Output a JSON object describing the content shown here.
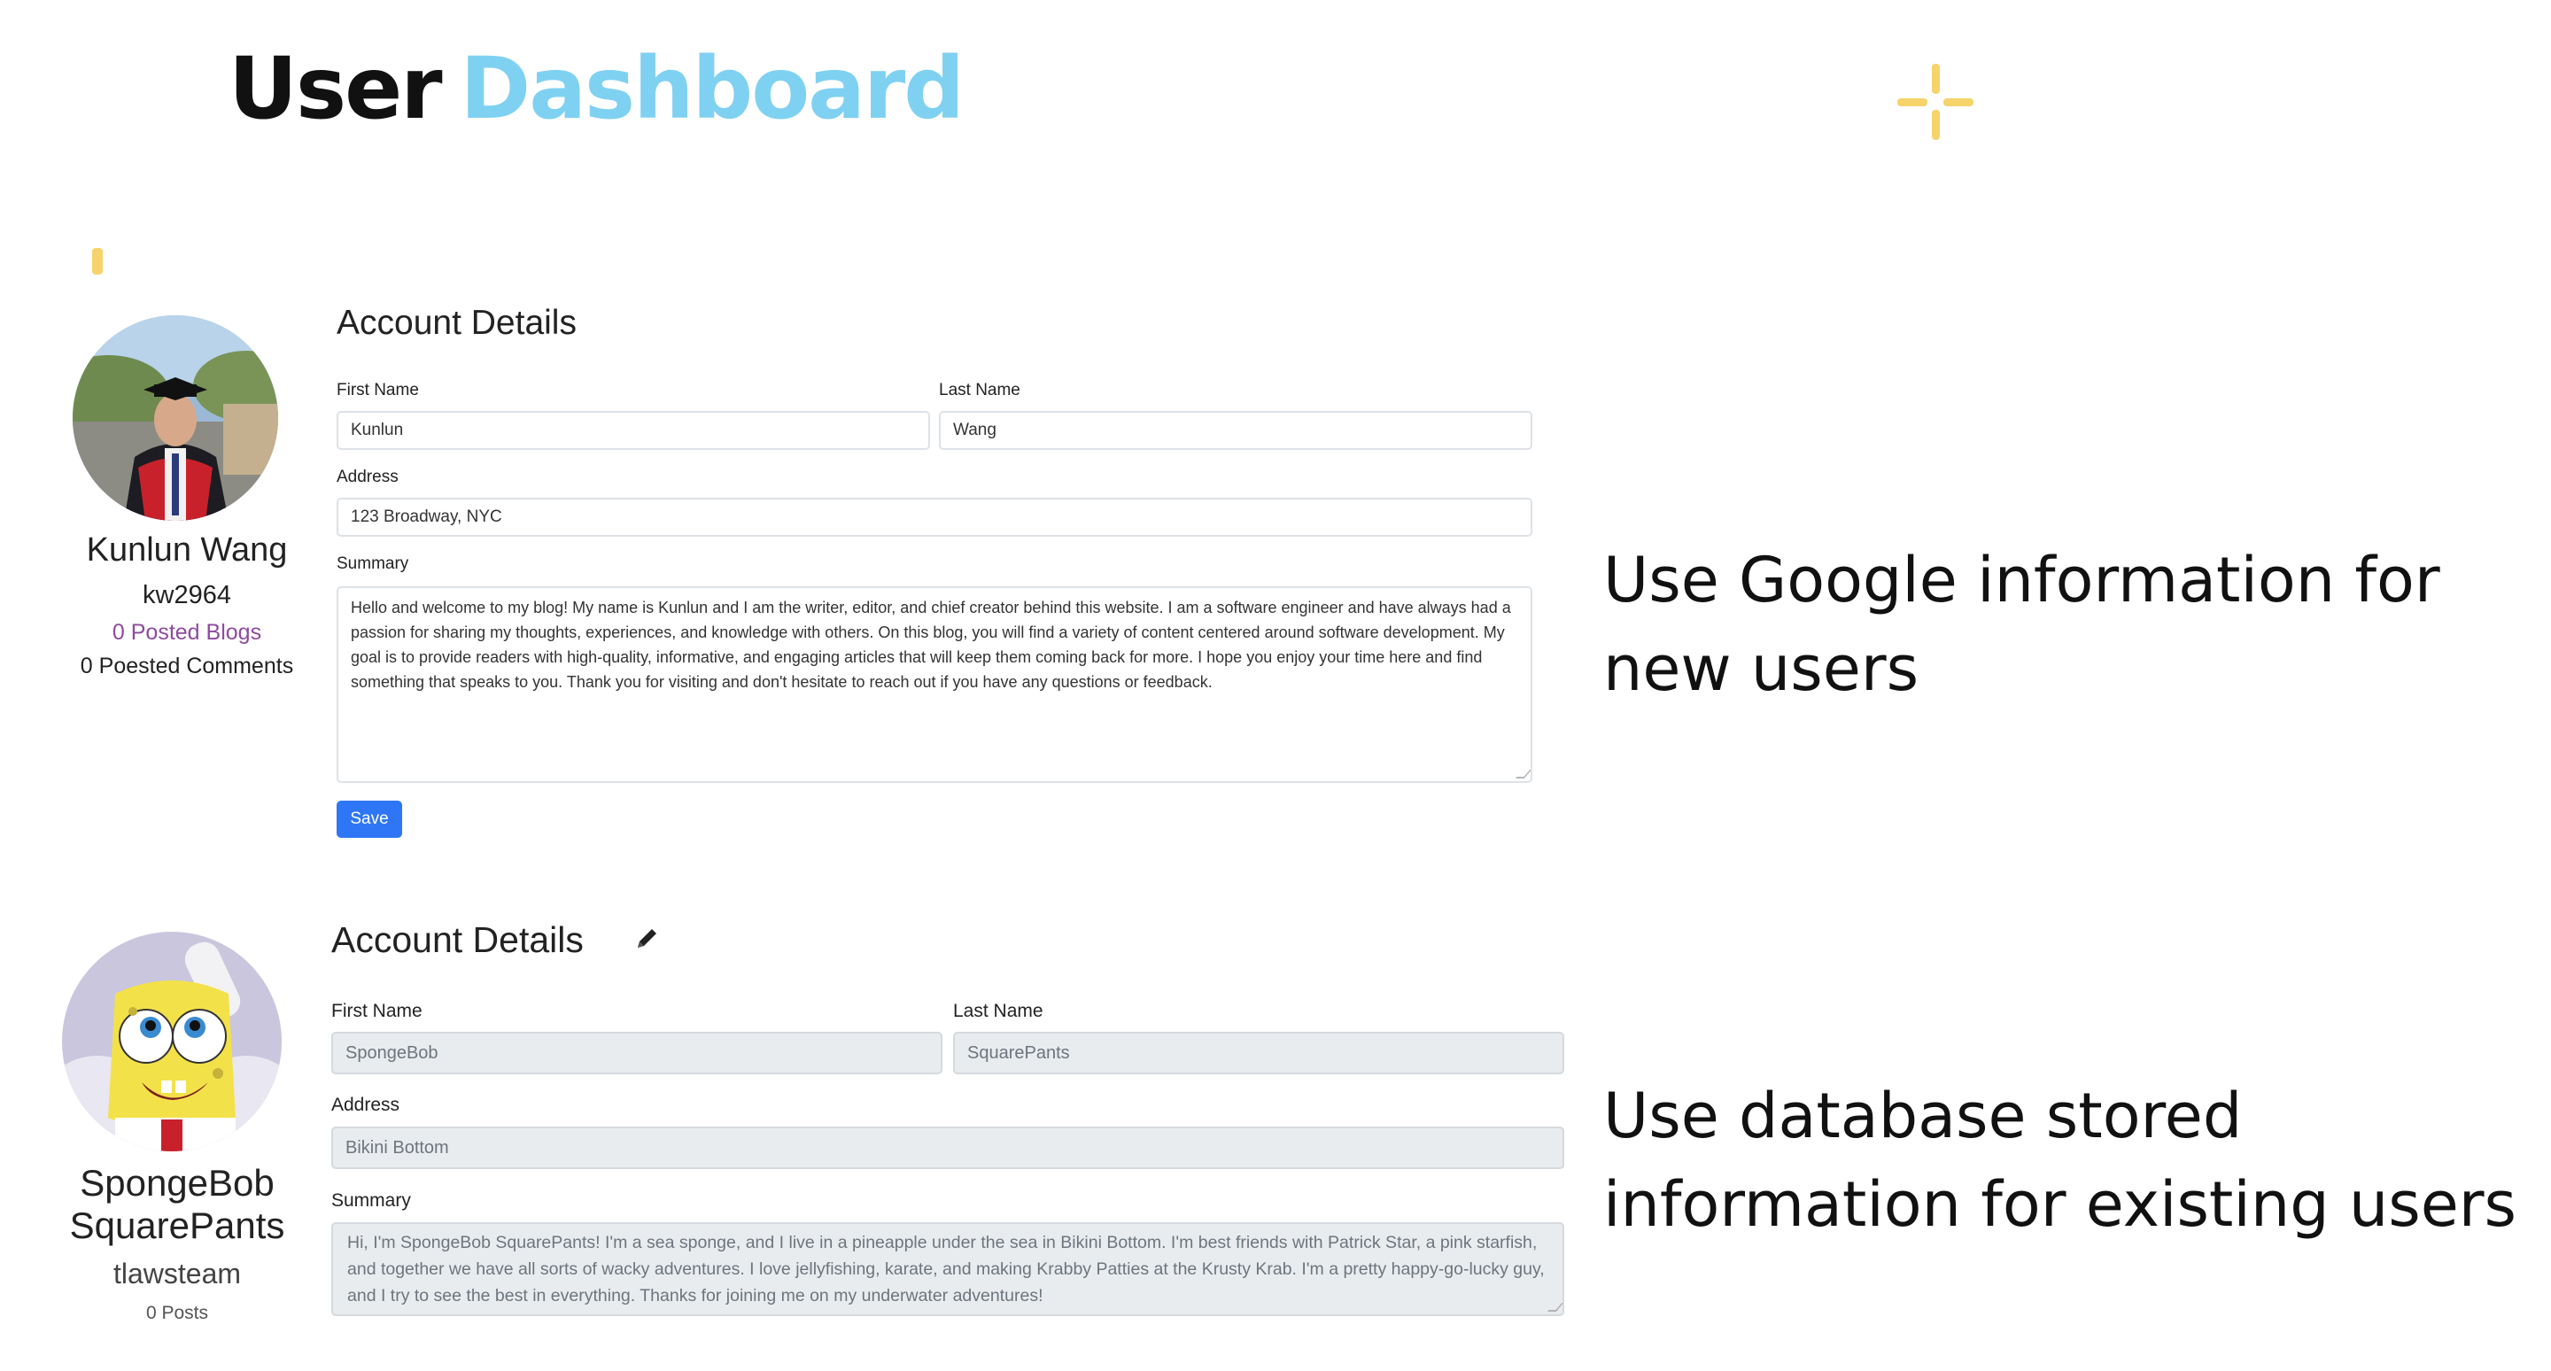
{
  "header": {
    "title_word1": "User",
    "title_word2": "Dashboard"
  },
  "notes": {
    "new_users": "Use Google information for new users",
    "existing_users": "Use database stored information for existing users"
  },
  "profile_new": {
    "name": "Kunlun Wang",
    "username": "kw2964",
    "blogs": "0 Posted Blogs",
    "comments": "0 Poested Comments"
  },
  "form_new": {
    "heading": "Account Details",
    "first_name_label": "First Name",
    "first_name_value": "Kunlun",
    "last_name_label": "Last Name",
    "last_name_value": "Wang",
    "address_label": "Address",
    "address_value": "123 Broadway, NYC",
    "summary_label": "Summary",
    "summary_value": "Hello and welcome to my blog! My name is Kunlun  and I am the writer, editor, and chief creator behind this website. I am a software engineer and have always had a passion for sharing my thoughts, experiences, and knowledge with others. On this blog, you will find a variety of content centered around software development. My goal is to provide readers with high-quality, informative, and engaging articles that will keep them coming back for more. I hope you enjoy your time here and find something that speaks to you. Thank you for visiting and don't hesitate to reach out if you have any questions or feedback.",
    "save_label": "Save"
  },
  "profile_existing": {
    "name": "SpongeBob SquarePants",
    "username": "tlawsteam",
    "posts": "0 Posts"
  },
  "form_existing": {
    "heading": "Account Details",
    "edit_icon": "pencil-icon",
    "first_name_label": "First Name",
    "first_name_value": "SpongeBob",
    "last_name_label": "Last Name",
    "last_name_value": "SquarePants",
    "address_label": "Address",
    "address_value": "Bikini Bottom",
    "summary_label": "Summary",
    "summary_value": "Hi, I'm SpongeBob SquarePants! I'm a sea sponge, and I live in a pineapple under the sea in Bikini Bottom. I'm best friends with Patrick Star, a pink starfish, and together we have all sorts of wacky adventures. I love jellyfishing, karate, and making Krabby Patties at the Krusty Krab. I'm a pretty happy-go-lucky guy, and I try to see the best in everything. Thanks for joining me on my underwater adventures!"
  },
  "colors": {
    "accent_blue": "#7fd1f2",
    "accent_yellow": "#f6d36b",
    "button_blue": "#2f76f6",
    "link_purple": "#8e4a9e"
  }
}
